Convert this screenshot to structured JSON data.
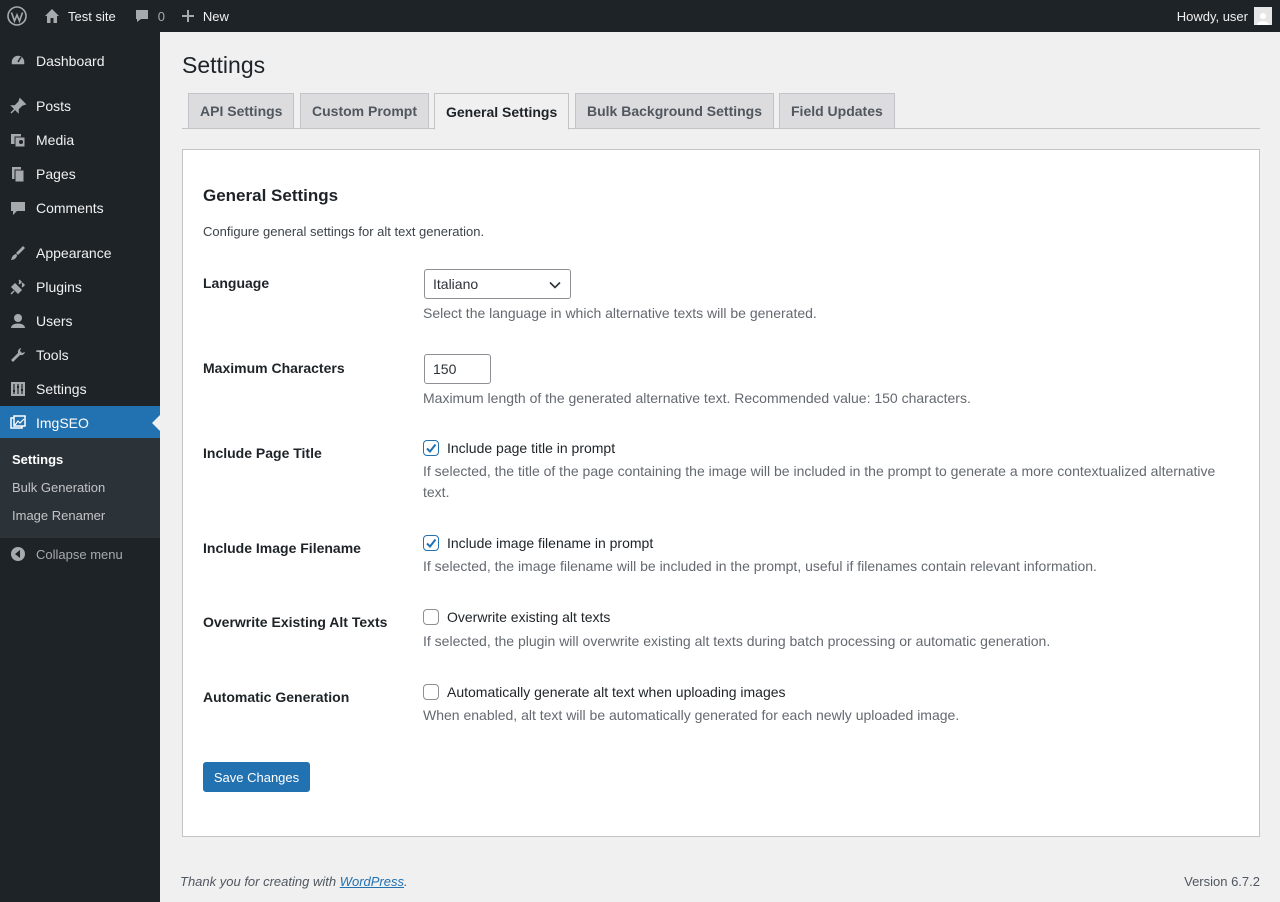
{
  "adminbar": {
    "site_name": "Test site",
    "comments_count": "0",
    "new_label": "New",
    "greeting": "Howdy, user"
  },
  "sidebar": {
    "items": [
      {
        "label": "Dashboard",
        "icon": "dashboard-icon"
      },
      {
        "label": "Posts",
        "icon": "pin-icon"
      },
      {
        "label": "Media",
        "icon": "media-icon"
      },
      {
        "label": "Pages",
        "icon": "pages-icon"
      },
      {
        "label": "Comments",
        "icon": "comment-icon"
      },
      {
        "label": "Appearance",
        "icon": "brush-icon"
      },
      {
        "label": "Plugins",
        "icon": "plugin-icon"
      },
      {
        "label": "Users",
        "icon": "user-icon"
      },
      {
        "label": "Tools",
        "icon": "wrench-icon"
      },
      {
        "label": "Settings",
        "icon": "sliders-icon"
      },
      {
        "label": "ImgSEO",
        "icon": "images-icon"
      }
    ],
    "submenu": [
      "Settings",
      "Bulk Generation",
      "Image Renamer"
    ],
    "collapse_label": "Collapse menu"
  },
  "page": {
    "title": "Settings",
    "tabs": [
      "API Settings",
      "Custom Prompt",
      "General Settings",
      "Bulk Background Settings",
      "Field Updates"
    ],
    "active_tab": "General Settings"
  },
  "section": {
    "heading": "General Settings",
    "intro": "Configure general settings for alt text generation."
  },
  "fields": {
    "language": {
      "label": "Language",
      "value": "Italiano",
      "description": "Select the language in which alternative texts will be generated."
    },
    "max_chars": {
      "label": "Maximum Characters",
      "value": "150",
      "description": "Maximum length of the generated alternative text. Recommended value: 150 characters."
    },
    "page_title": {
      "label": "Include Page Title",
      "checkbox_label": "Include page title in prompt",
      "checked": true,
      "description_line1": "If selected, the title of the page containing the image will be included in the prompt to generate a more contextualized alternative",
      "description_line2": "text."
    },
    "filename": {
      "label": "Include Image Filename",
      "checkbox_label": "Include image filename in prompt",
      "checked": true,
      "description": "If selected, the image filename will be included in the prompt, useful if filenames contain relevant information."
    },
    "overwrite": {
      "label": "Overwrite Existing Alt Texts",
      "checkbox_label": "Overwrite existing alt texts",
      "checked": false,
      "description": "If selected, the plugin will overwrite existing alt texts during batch processing or automatic generation."
    },
    "auto": {
      "label": "Automatic Generation",
      "checkbox_label": "Automatically generate alt text when uploading images",
      "checked": false,
      "description": "When enabled, alt text will be automatically generated for each newly uploaded image."
    }
  },
  "save_label": "Save Changes",
  "footer": {
    "thanks_prefix": "Thank you for creating with ",
    "link_text": "WordPress",
    "thanks_suffix": ".",
    "version": "Version 6.7.2"
  },
  "colors": {
    "accent": "#2271b1",
    "sidebar_bg": "#1d2327",
    "submenu_bg": "#2c3338",
    "page_bg": "#f0f0f1"
  }
}
